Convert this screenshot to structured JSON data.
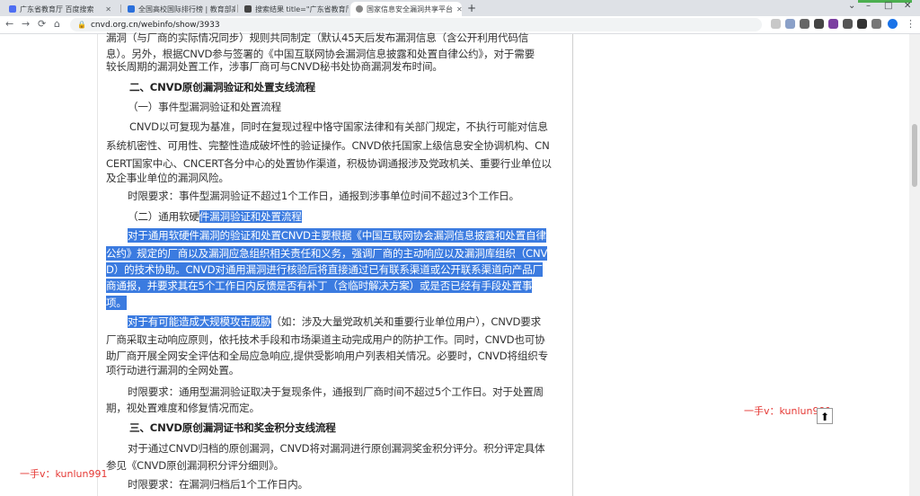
{
  "tabs": [
    {
      "title": "广东省教育厅 百度搜索",
      "color": "#4e6ef2"
    },
    {
      "title": "全国高校国际排行榜 | 教育部高...",
      "color": "#2a6fdb"
    },
    {
      "title": "搜索结果 title=\"广东省教育厅\" ...",
      "color": "#444"
    },
    {
      "title": "国家信息安全漏洞共享平台",
      "color": "#888"
    }
  ],
  "address": "cnvd.org.cn/webinfo/show/3933",
  "article": {
    "p0a": "漏洞（与厂商的实际情况同步）规则共同制定（默认45天后发布漏洞信息（含公开利用代码信",
    "p0b": "息）。另外，根据CNVD参与签署的《中国互联网协会漏洞信息披露和处置自律公约》，对于需要",
    "p0c": "较长周期的漏洞处置工作，涉事厂商可与CNVD秘书处协商漏洞发布时间。",
    "h2": "二、CNVD原创漏洞验证和处置支线流程",
    "sub1": "（一）事件型漏洞验证和处置流程",
    "p1a": "CNVD以可复现为基准，同时在复现过程中恪守国家法律和有关部门规定，不执行可能对信息",
    "p1b": "系统机密性、可用性、完整性造成破坏性的验证操作。CNVD依托国家上级信息安全协调机构、CN",
    "p1c": "CERT国家中心、CNCERT各分中心的处置协作渠道，积极协调通报涉及党政机关、重要行业单位以",
    "p1d": "及企事业单位的漏洞风险。",
    "t1": "时限要求：事件型漏洞验证不超过1个工作日，通报到涉事单位时间不超过3个工作日。",
    "sub2a": "（二）通用软硬",
    "sub2b": "件漏洞验证和处置流程",
    "p2a": "对于通用软硬件漏洞的验证和处置CNVD主要根据《中国互联网协会漏洞信息披露和处置自律",
    "p2b": "公约》规定的厂商以及漏洞应急组织相关责任和义务，强调厂商的主动响应以及漏洞库组织（CNV",
    "p2c": "D）的技术协助。CNVD对通用漏洞进行核验后将直接通过已有联系渠道或公开联系渠道向产品厂",
    "p2d": "商通报，并要求其在5个工作日内反馈是否有补丁（含临时解决方案）或是否已经有手段处置事",
    "p2e": "项。",
    "p3a1": "对于有可能造成大规模攻击威胁",
    "p3a2": "（如：涉及大量党政机关和重要行业单位用户），CNVD要求",
    "p3b": "厂商采取主动响应原则，依托技术手段和市场渠道主动完成用户的防护工作。同时，CNVD也可协",
    "p3c": "助厂商开展全网安全评估和全局应急响应,提供受影响用户列表相关情况。必要时，CNVD将组织专",
    "p3d": "项行动进行漏洞的全网处置。",
    "t2a": "时限要求：通用型漏洞验证取决于复现条件，通报到厂商时间不超过5个工作日。对于处置周",
    "t2b": "期，视处置难度和修复情况而定。",
    "h3": "三、CNVD原创漏洞证书和奖金积分支线流程",
    "p4a": "对于通过CNVD归档的原创漏洞，CNVD将对漏洞进行原创漏洞奖金积分评分。积分评定具体",
    "p4b": "参见《CNVD原创漏洞积分评分细则》。",
    "t3": "时限要求：在漏洞归档后1个工作日内。"
  },
  "watermark": "一手v：kunlun991"
}
